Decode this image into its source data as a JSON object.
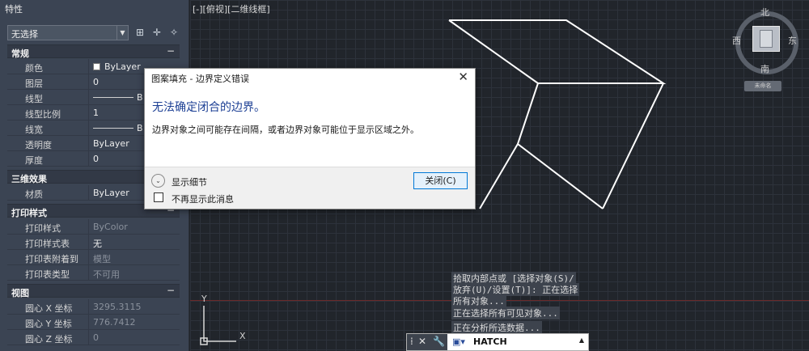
{
  "palette": {
    "title": "特性",
    "selection": "无选择",
    "sections": {
      "general": "常规",
      "3d": "三维效果",
      "plot": "打印样式",
      "view": "视图"
    },
    "general_rows": [
      {
        "label": "颜色",
        "value": "ByLayer"
      },
      {
        "label": "图层",
        "value": "0"
      },
      {
        "label": "线型",
        "value": "B"
      },
      {
        "label": "线型比例",
        "value": "1"
      },
      {
        "label": "线宽",
        "value": "B"
      },
      {
        "label": "透明度",
        "value": "ByLayer"
      },
      {
        "label": "厚度",
        "value": "0"
      }
    ],
    "effects_rows": [
      {
        "label": "材质",
        "value": "ByLayer"
      }
    ],
    "plot_rows": [
      {
        "label": "打印样式",
        "value": "ByColor"
      },
      {
        "label": "打印样式表",
        "value": "无"
      },
      {
        "label": "打印表附着到",
        "value": "模型"
      },
      {
        "label": "打印表类型",
        "value": "不可用"
      }
    ],
    "view_rows": [
      {
        "label": "圆心 X 坐标",
        "value": "3295.3115"
      },
      {
        "label": "圆心 Y 坐标",
        "value": "776.7412"
      },
      {
        "label": "圆心 Z 坐标",
        "value": "0"
      }
    ]
  },
  "viewport": {
    "label": "[-][俯视][二维线框]",
    "compass": {
      "north": "北",
      "south": "南",
      "east": "东",
      "west": "西",
      "cube_face": "上",
      "wcs": "未命名"
    },
    "ucs": {
      "x": "X",
      "y": "Y"
    }
  },
  "command": {
    "history": [
      "拾取内部点或 [选择对象(S)/",
      "放弃(U)/设置(T)]: 正在选择",
      "所有对象...",
      "正在选择所有可见对象...",
      "正在分析所选数据..."
    ],
    "current": "HATCH"
  },
  "dialog": {
    "title": "图案填充 - 边界定义错误",
    "heading": "无法确定闭合的边界。",
    "body": "边界对象之间可能存在间隔，或者边界对象可能位于显示区域之外。",
    "details": "显示细节",
    "checkbox": "不再显示此消息",
    "button": "关闭(C)"
  }
}
